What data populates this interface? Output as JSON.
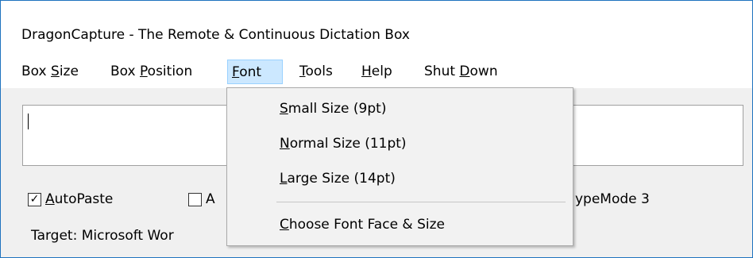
{
  "window": {
    "title": "DragonCapture - The Remote & Continuous Dictation Box"
  },
  "menubar": {
    "items": [
      {
        "pre": "Box ",
        "u": "S",
        "post": "ize"
      },
      {
        "pre": "Box ",
        "u": "P",
        "post": "osition"
      },
      {
        "pre": "",
        "u": "F",
        "post": "ont"
      },
      {
        "pre": "",
        "u": "T",
        "post": "ools"
      },
      {
        "pre": "",
        "u": "H",
        "post": "elp"
      },
      {
        "pre": "Shut ",
        "u": "D",
        "post": "own"
      }
    ],
    "active": "Font"
  },
  "dictation_box": {
    "value": ""
  },
  "options": {
    "autopaste": {
      "u": "A",
      "post": "utoPaste",
      "checked": true,
      "mark": "✓"
    },
    "second_checkbox": {
      "visible_text": "A",
      "checked": false
    },
    "typemode_text": "ypeMode 3"
  },
  "target": {
    "text": "Target: Microsoft Wor"
  },
  "font_menu": {
    "items": [
      {
        "u": "S",
        "post": "mall Size (9pt)"
      },
      {
        "u": "N",
        "post": "ormal Size (11pt)"
      },
      {
        "u": "L",
        "post": "arge Size (14pt)"
      },
      {
        "u": "C",
        "post": "hoose Font Face & Size"
      }
    ]
  }
}
